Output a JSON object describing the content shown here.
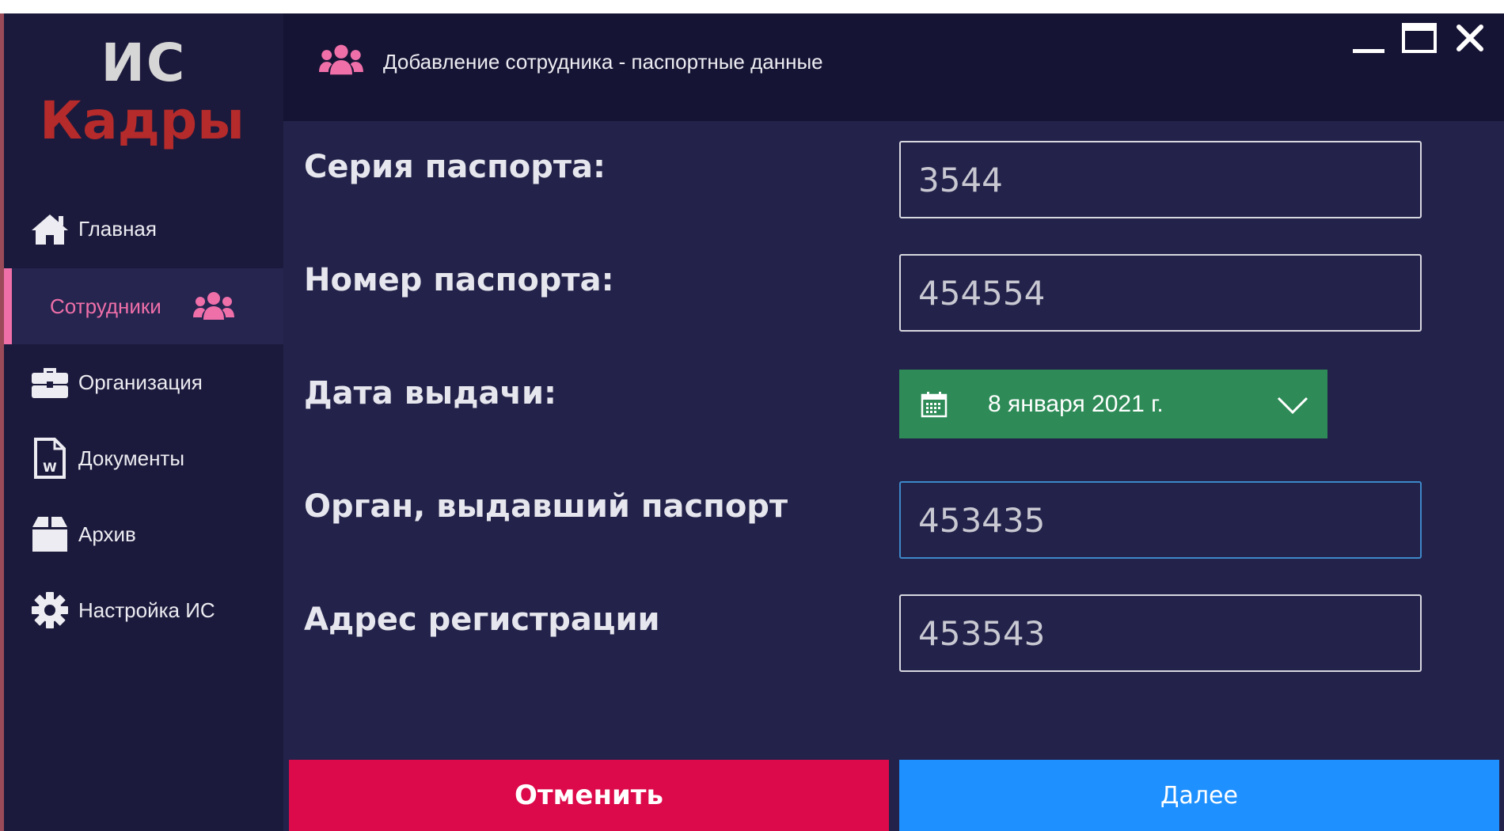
{
  "app": {
    "logo_line1": "ИС",
    "logo_line2": "Кадры"
  },
  "header": {
    "title": "Добавление сотрудника - паспортные данные",
    "icon": "users-icon"
  },
  "sidebar": {
    "items": [
      {
        "label": "Главная",
        "icon": "home-icon",
        "active": false
      },
      {
        "label": "Сотрудники",
        "icon": "users-icon",
        "active": true
      },
      {
        "label": "Организация",
        "icon": "briefcase-icon",
        "active": false
      },
      {
        "label": "Документы",
        "icon": "word-document-icon",
        "active": false
      },
      {
        "label": "Архив",
        "icon": "archive-box-icon",
        "active": false
      },
      {
        "label": "Настройка ИС",
        "icon": "gear-icon",
        "active": false
      }
    ]
  },
  "form": {
    "passport_series": {
      "label": "Серия паспорта:",
      "value": "3544"
    },
    "passport_number": {
      "label": "Номер паспорта:",
      "value": "454554"
    },
    "issue_date": {
      "label": "Дата выдачи:",
      "value": "8 января 2021 г."
    },
    "issued_by": {
      "label": "Орган, выдавший паспорт",
      "value": "453435"
    },
    "registration_address": {
      "label": "Адрес регистрации",
      "value": "453543"
    }
  },
  "buttons": {
    "cancel": "Отменить",
    "next": "Далее"
  },
  "colors": {
    "accent_pink": "#ef6fa9",
    "cancel_red": "#dc0a4a",
    "next_blue": "#1e90ff",
    "date_green": "#2e8b57",
    "logo_red": "#b52a2a"
  }
}
